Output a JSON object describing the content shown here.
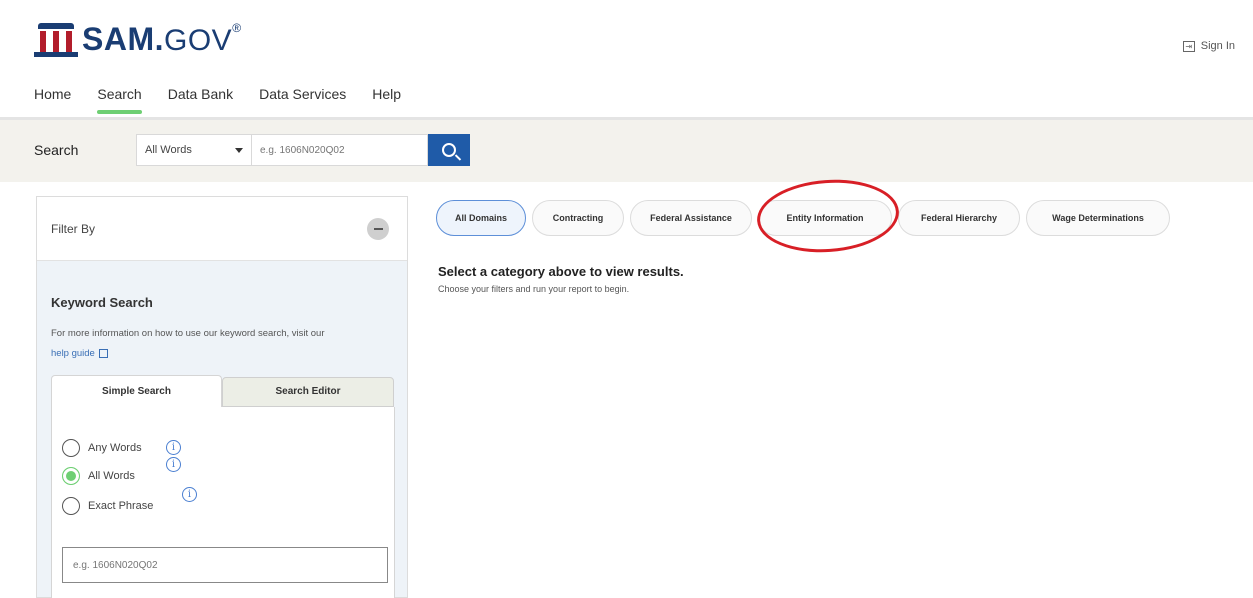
{
  "header": {
    "logo_main": "SAM.",
    "logo_gov": "GOV",
    "logo_tm": "®",
    "signin_label": "Sign In"
  },
  "nav": {
    "items": [
      {
        "label": "Home",
        "active": false
      },
      {
        "label": "Search",
        "active": true
      },
      {
        "label": "Data Bank",
        "active": false
      },
      {
        "label": "Data Services",
        "active": false
      },
      {
        "label": "Help",
        "active": false
      }
    ]
  },
  "searchbar": {
    "label": "Search",
    "select_value": "All Words",
    "input_placeholder": "e.g. 1606N020Q02"
  },
  "sidebar": {
    "filter_title": "Filter By",
    "keyword_title": "Keyword Search",
    "keyword_desc": "For more information on how to use our keyword search, visit our",
    "help_link": "help guide",
    "tabs": {
      "simple": "Simple Search",
      "editor": "Search Editor"
    },
    "options": [
      {
        "label": "Any Words",
        "checked": false
      },
      {
        "label": "All Words",
        "checked": true
      },
      {
        "label": "Exact Phrase",
        "checked": false
      }
    ],
    "keyword_placeholder": "e.g. 1606N020Q02"
  },
  "domains": [
    {
      "label": "All Domains",
      "active": true
    },
    {
      "label": "Contracting",
      "active": false
    },
    {
      "label": "Federal Assistance",
      "active": false
    },
    {
      "label": "Entity Information",
      "active": false
    },
    {
      "label": "Federal Hierarchy",
      "active": false
    },
    {
      "label": "Wage Determinations",
      "active": false
    }
  ],
  "results": {
    "title": "Select a category above to view results.",
    "subtitle": "Choose your filters and run your report to begin."
  },
  "colors": {
    "brand_blue": "#1a3d73",
    "brand_red": "#b21d2b",
    "accent_green": "#6ecf73",
    "search_button": "#1f5ba8",
    "annotation_red": "#d81f26"
  }
}
